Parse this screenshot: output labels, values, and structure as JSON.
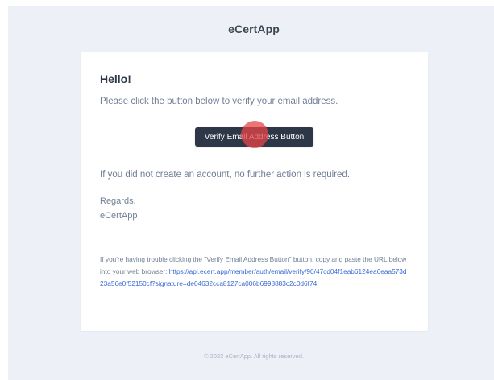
{
  "header": {
    "app_name": "eCertApp"
  },
  "card": {
    "greeting": "Hello!",
    "intro": "Please click the button below to verify your email address.",
    "button_label": "Verify Email Address Button",
    "no_action": "If you did not create an account, no further action is required.",
    "regards_label": "Regards,",
    "regards_name": "eCertApp",
    "subcopy_text": "If you're having trouble clicking the \"Verify Email Address Button\" button, copy and paste the URL below into your web browser: ",
    "verify_url": "https://api.ecert.app/member/auth/email/verify/90/47cd04f1eab6124ea6eaa573d23a56e0f52150cf?signature=de04632cca8127ca006b6998883c2c0d6f74"
  },
  "footer": {
    "copyright": "© 2022 eCertApp. All rights reserved."
  },
  "colors": {
    "background": "#edf0f6",
    "card": "#ffffff",
    "button": "#2d3748",
    "link": "#3869d4",
    "click_marker": "#e64646"
  }
}
